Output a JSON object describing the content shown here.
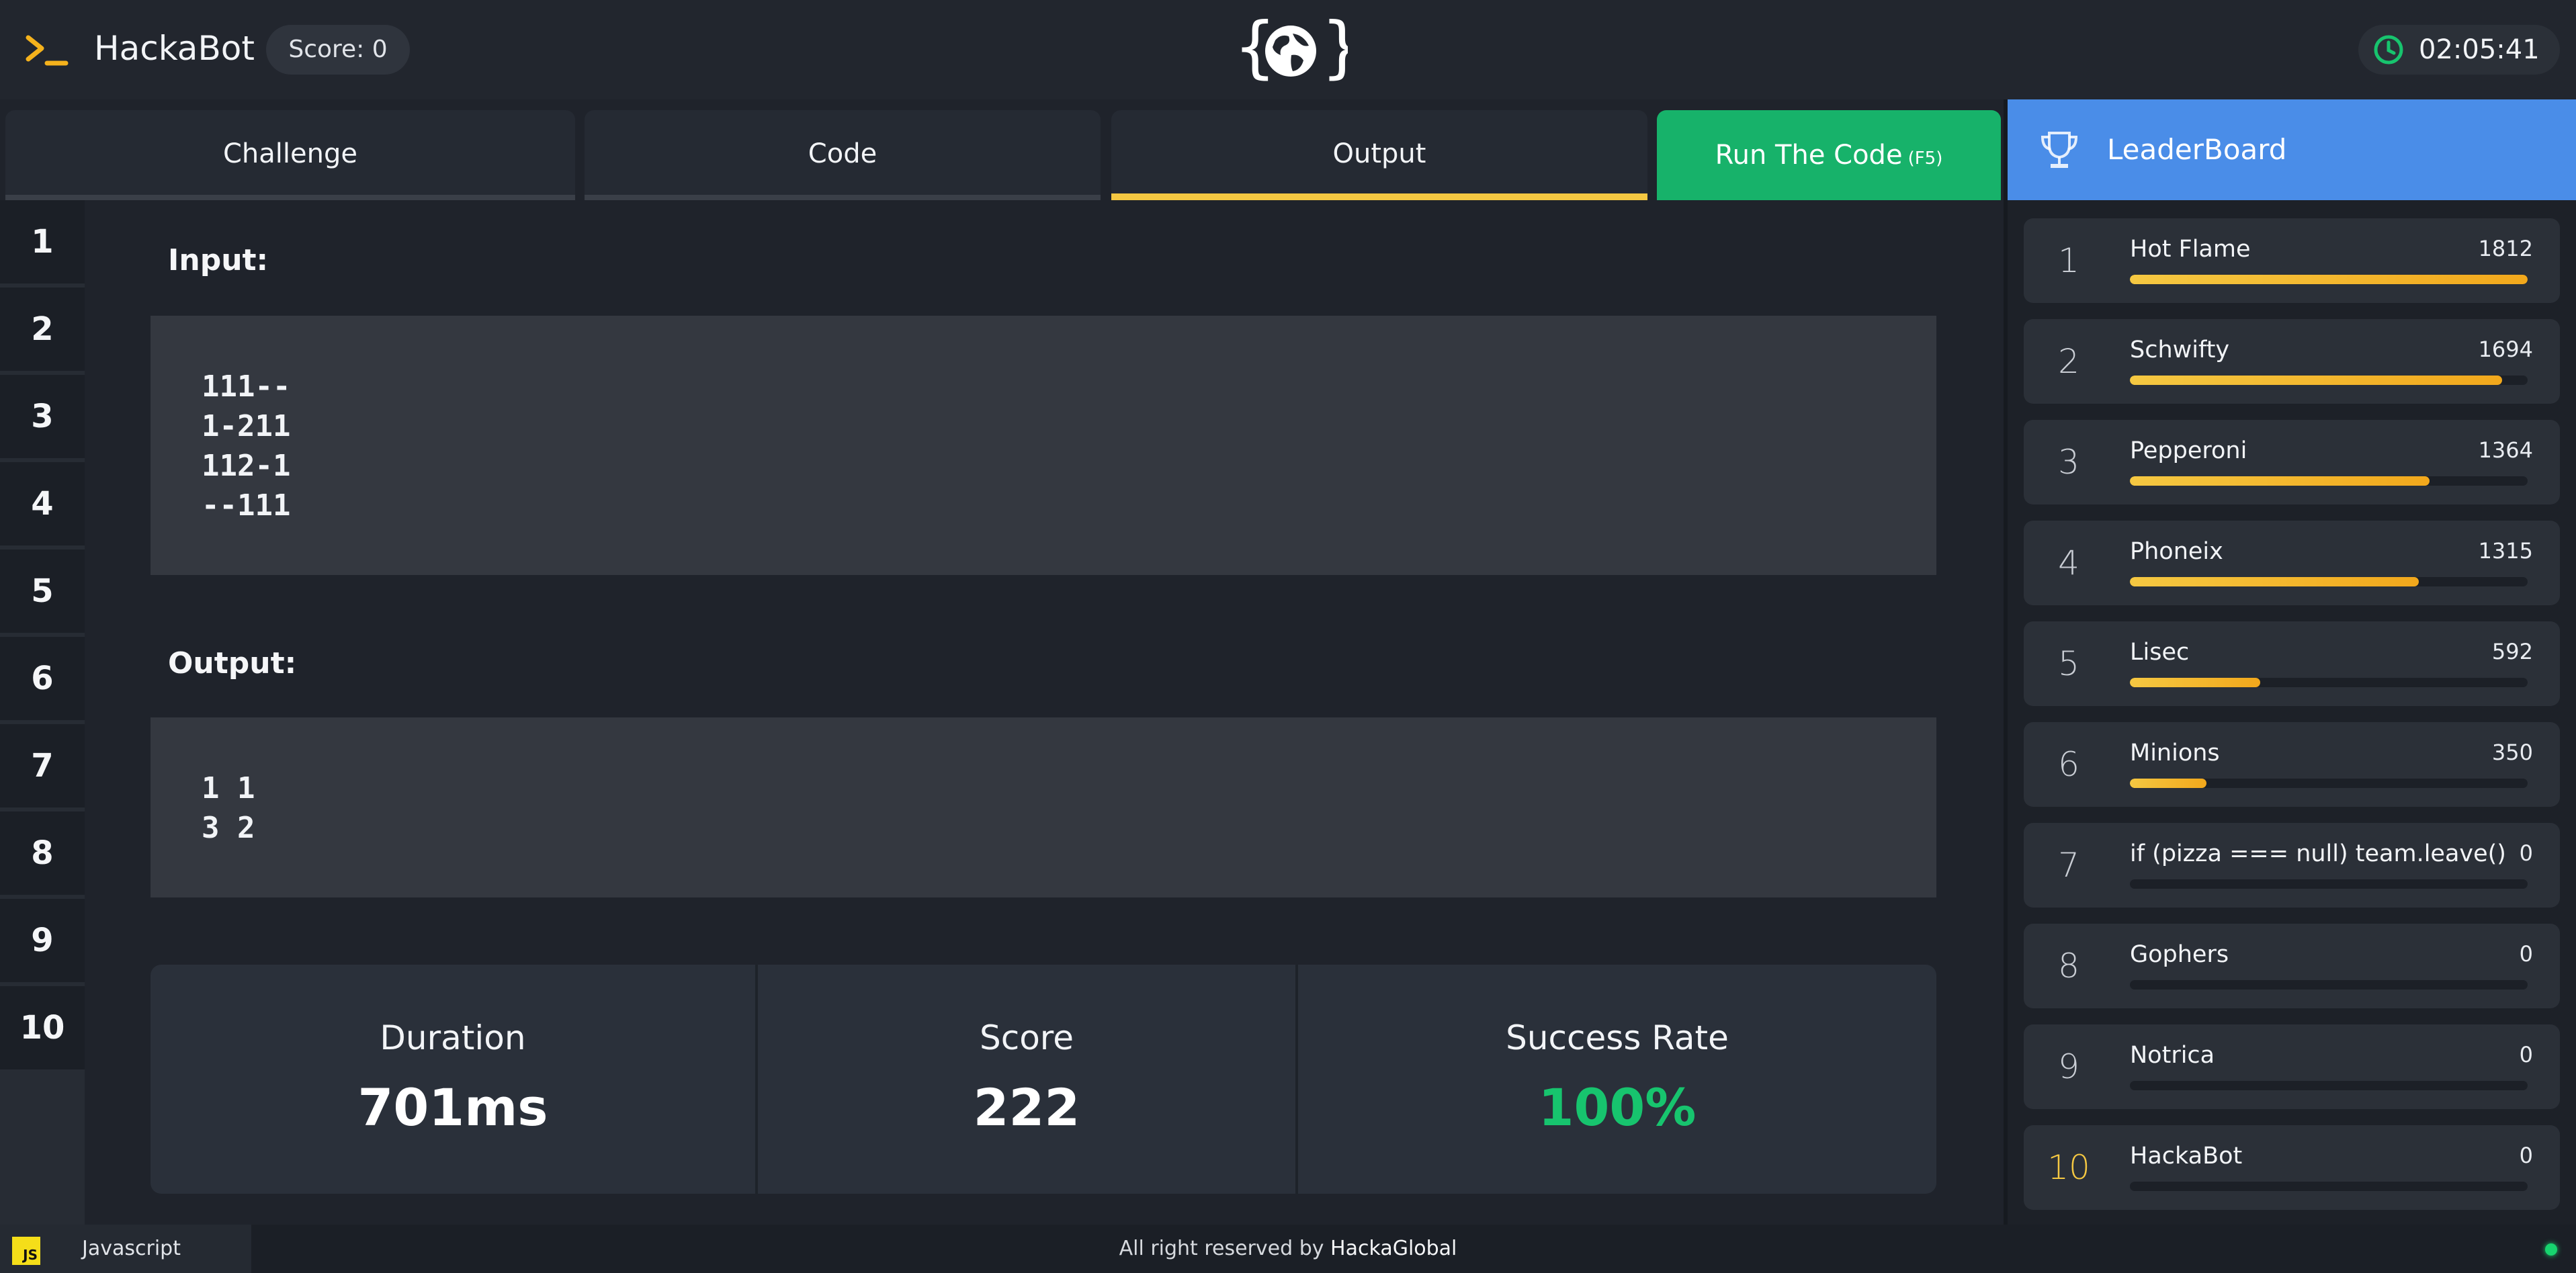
{
  "app": {
    "name": "HackaBot",
    "score_label": "Score: 0",
    "timer": "02:05:41"
  },
  "tabs": [
    {
      "label": "Challenge"
    },
    {
      "label": "Code"
    },
    {
      "label": "Output"
    }
  ],
  "run_button": {
    "label": "Run The Code",
    "shortcut": "(F5)"
  },
  "rail": [
    "1",
    "2",
    "3",
    "4",
    "5",
    "6",
    "7",
    "8",
    "9",
    "10"
  ],
  "input": {
    "label": "Input:",
    "lines": [
      "111--",
      "1-211",
      "112-1",
      "--111"
    ]
  },
  "output": {
    "label": "Output:",
    "lines": [
      "1 1",
      "3 2"
    ]
  },
  "stats": {
    "duration_label": "Duration",
    "duration_value": "701ms",
    "score_label": "Score",
    "score_value": "222",
    "success_label": "Success Rate",
    "success_value": "100%"
  },
  "leaderboard": {
    "title": "LeaderBoard",
    "rows": [
      {
        "rank": "1",
        "name": "Hot Flame",
        "score": "1812",
        "fill": 1.0
      },
      {
        "rank": "2",
        "name": "Schwifty",
        "score": "1694",
        "fill": 0.935
      },
      {
        "rank": "3",
        "name": "Pepperoni",
        "score": "1364",
        "fill": 0.753
      },
      {
        "rank": "4",
        "name": "Phoneix",
        "score": "1315",
        "fill": 0.726
      },
      {
        "rank": "5",
        "name": "Lisec",
        "score": "592",
        "fill": 0.327
      },
      {
        "rank": "6",
        "name": "Minions",
        "score": "350",
        "fill": 0.193
      },
      {
        "rank": "7",
        "name": "if (pizza === null) team.leave()",
        "score": "0",
        "fill": 0
      },
      {
        "rank": "8",
        "name": "Gophers",
        "score": "0",
        "fill": 0
      },
      {
        "rank": "9",
        "name": "Notrica",
        "score": "0",
        "fill": 0
      },
      {
        "rank": "10",
        "name": "HackaBot",
        "score": "0",
        "fill": 0
      }
    ]
  },
  "footer": {
    "language": "Javascript",
    "badge": "JS",
    "copyright_prefix": "All right reserved by ",
    "copyright_brand": "HackaGlobal"
  },
  "colors": {
    "accent": "#f5c842",
    "run": "#17b26a",
    "leaderboard": "#4a8de8",
    "success": "#17c46e"
  }
}
